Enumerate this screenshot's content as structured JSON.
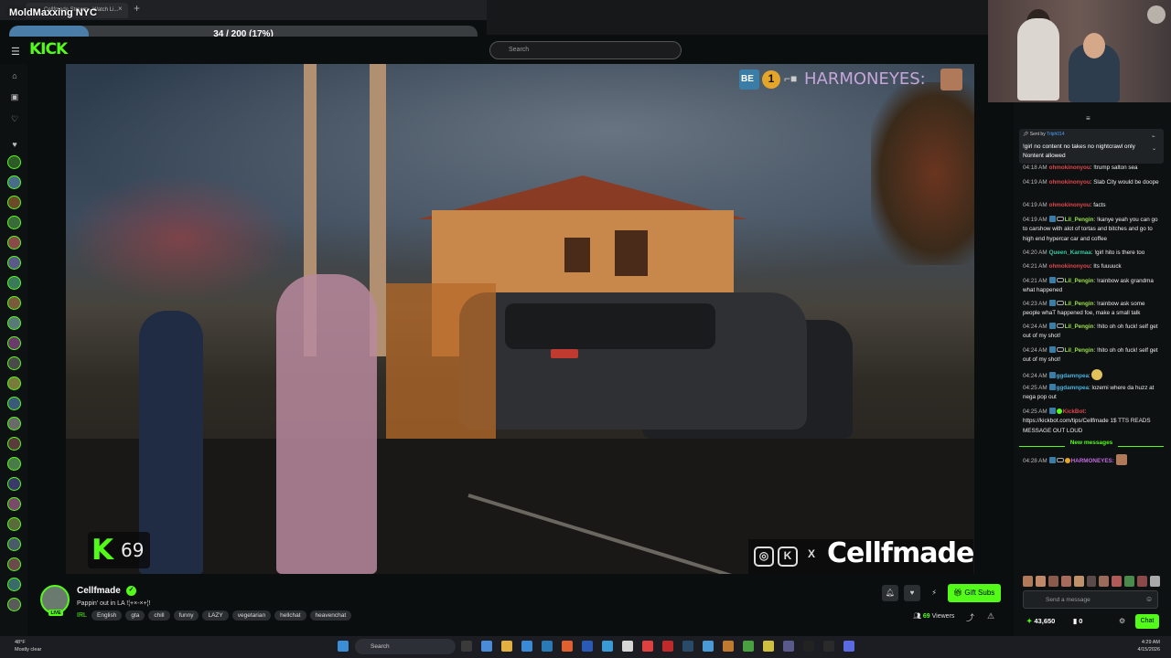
{
  "overlay": {
    "title": "MoldMaxxing NYC",
    "progress_text": "34 / 200 (17%)",
    "progress_fraction": 0.17
  },
  "browser": {
    "tab_title": "Cellfmade Stream - Watch Li...",
    "tab_close": "×",
    "new_tab": "+"
  },
  "header": {
    "logo": "KICK",
    "search_placeholder": "Search"
  },
  "video": {
    "hype_label": "HARMONEYES:",
    "hype_count": "1",
    "kick_badge_count": "69",
    "social_handle": "Cellfmade"
  },
  "channel": {
    "name": "Cellfmade",
    "live_label": "LIVE",
    "title": "Pappin' out in LA !¦+×-×+¦!",
    "category": "IRL",
    "tags": [
      "English",
      "gta",
      "chill",
      "funny",
      "LAZY",
      "vegetarian",
      "hellchat",
      "heavenchat"
    ],
    "gift_label": "Gift Subs",
    "viewers_count": "69",
    "viewers_label": "Viewers"
  },
  "chat": {
    "pinned_by_label": "Sent by",
    "pinned_by_user": "Trlph014",
    "pinned_message": "!girl no content no takes no nightcrawl only Nontent allowed",
    "messages": [
      {
        "ts": "04:18 AM",
        "user": "ohmokinonyou",
        "color": "#e0464c",
        "text": "!trump salton sea"
      },
      {
        "ts": "04:19 AM",
        "user": "ohmokinonyou",
        "color": "#e0464c",
        "text": "Slab City would be doope"
      },
      {
        "ts": "04:19 AM",
        "user": "ohmokinonyou",
        "color": "#e0464c",
        "text": "facts"
      },
      {
        "ts": "04:19 AM",
        "user": "Lil_Pengin",
        "color": "#9be04a",
        "text": "!kanye yeah you can go to carshow with alot of tortas and bitches and go to high end hypercar car and coffee"
      },
      {
        "ts": "04:20 AM",
        "user": "Queen_Karmaa",
        "color": "#38c7a0",
        "text": "!girl hito is there too"
      },
      {
        "ts": "04:21 AM",
        "user": "ohmokinonyou",
        "color": "#e0464c",
        "text": "Its fuuuuck"
      },
      {
        "ts": "04:21 AM",
        "user": "Lil_Pengin",
        "color": "#9be04a",
        "text": "!rainbow ask grandma what happened"
      },
      {
        "ts": "04:23 AM",
        "user": "Lil_Pengin",
        "color": "#9be04a",
        "text": "!rainbow ask some people whaT happened foe, make a small talk"
      },
      {
        "ts": "04:24 AM",
        "user": "Lil_Pengin",
        "color": "#9be04a",
        "text": "!hito oh oh fuck! self get out of my shot!"
      },
      {
        "ts": "04:24 AM",
        "user": "Lil_Pengin",
        "color": "#9be04a",
        "text": "!hito oh oh fuck! self get out of my shot!"
      },
      {
        "ts": "04:24 AM",
        "user": "ggdamnpea",
        "color": "#4ab2e0",
        "text": ""
      },
      {
        "ts": "04:25 AM",
        "user": "ggdamnpea",
        "color": "#4ab2e0",
        "text": "lozemi where da huzz at nega pop out"
      },
      {
        "ts": "04:25 AM",
        "user": "KickBot",
        "color": "#e0464c",
        "text": "https://kickbot.com/tips/Cellfmade 1$ TTS READS MESSAGE OUT LOUD"
      }
    ],
    "new_messages_label": "New messages",
    "last_message": {
      "ts": "04:28 AM",
      "user": "HARMONEYES:",
      "color": "#c26ae0"
    },
    "input_placeholder": "Send a message",
    "points": "43,650",
    "zero_count": "0",
    "chat_button": "Chat"
  },
  "taskbar": {
    "weather_temp": "48°F",
    "weather_desc": "Mostly clear",
    "search_label": "Search",
    "time": "4:29 AM",
    "date": "4/15/2026"
  },
  "icons": {
    "hamburger": "menu-icon",
    "search": "search-icon",
    "bell": "bell-icon",
    "heart": "heart-icon",
    "gear": "gear-icon",
    "share": "share-icon",
    "warning": "warning-icon"
  },
  "colors": {
    "kick_green": "#53fc18",
    "progress_blue": "#4a7ea8",
    "background": "#0b0e0f"
  }
}
